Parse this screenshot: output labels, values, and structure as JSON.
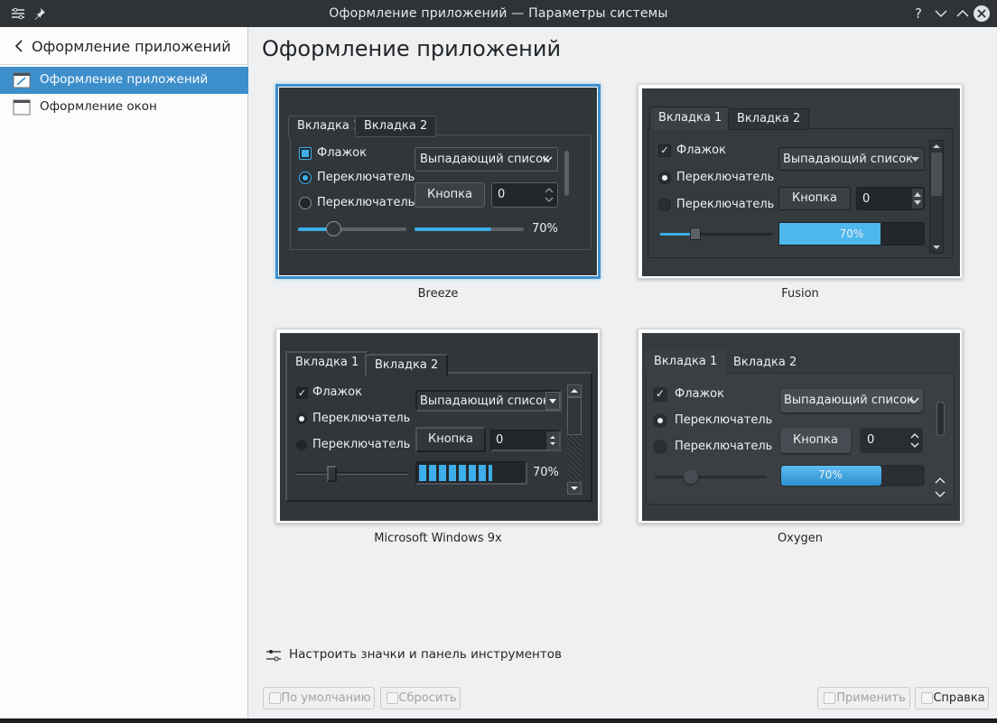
{
  "window": {
    "title": "Оформление приложений — Параметры системы"
  },
  "sidebar": {
    "back_title": "Оформление приложений",
    "items": [
      {
        "label": "Оформление приложений",
        "selected": true
      },
      {
        "label": "Оформление окон",
        "selected": false
      }
    ]
  },
  "main": {
    "title": "Оформление приложений",
    "preview": {
      "tab1": "Вкладка 1",
      "tab2": "Вкладка 2",
      "checkbox": "Флажок",
      "radio": "Переключатель",
      "dropdown": "Выпадающий список",
      "button": "Кнопка",
      "spin_value": "0",
      "progress_label": "70%",
      "progress_value": 0.7
    },
    "styles": [
      {
        "name": "Breeze",
        "selected": true
      },
      {
        "name": "Fusion",
        "selected": false
      },
      {
        "name": "Microsoft Windows 9x",
        "selected": false
      },
      {
        "name": "Oxygen",
        "selected": false
      }
    ],
    "configure_link": "Настроить значки и панель инструментов"
  },
  "footer": {
    "defaults": "По умолчанию",
    "reset": "Сбросить",
    "apply": "Применить",
    "help": "Справка"
  },
  "colors": {
    "accent": "#3daee9",
    "selection": "#3d8fcc",
    "preview_bg": "#31363b"
  }
}
